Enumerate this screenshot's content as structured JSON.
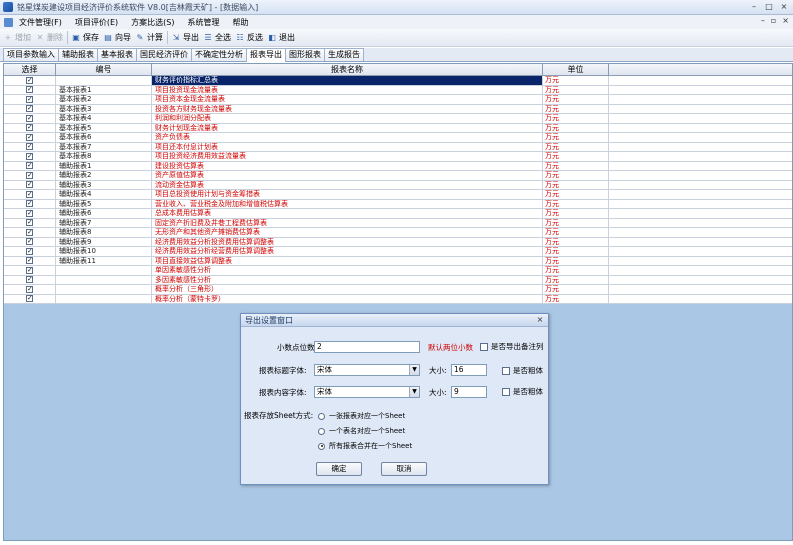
{
  "window": {
    "title": "铭星煤炭建设项目经济评价系统软件 V8.0[吉林霞天矿] - [数据输入]",
    "controls": {
      "minimize": "–",
      "maximize": "□",
      "close": "×"
    }
  },
  "menubar": {
    "items": [
      "文件管理(F)",
      "项目评价(E)",
      "方案比选(S)",
      "系统管理",
      "帮助"
    ],
    "sub_controls": {
      "minimize": "–",
      "restore": "▫",
      "close": "×"
    }
  },
  "toolbar": {
    "buttons": [
      {
        "label": "增加",
        "icon": "add-icon",
        "glyph": "+",
        "enabled": false
      },
      {
        "label": "删除",
        "icon": "delete-icon",
        "glyph": "✕",
        "enabled": false
      },
      {
        "label": "保存",
        "icon": "save-icon",
        "glyph": "▣",
        "enabled": true
      },
      {
        "label": "向导",
        "icon": "wizard-icon",
        "glyph": "▤",
        "enabled": true
      },
      {
        "label": "计算",
        "icon": "calculate-icon",
        "glyph": "✎",
        "enabled": true
      },
      {
        "label": "导出",
        "icon": "export-icon",
        "glyph": "⇲",
        "enabled": true
      },
      {
        "label": "全选",
        "icon": "select-all-icon",
        "glyph": "☰",
        "enabled": true
      },
      {
        "label": "反选",
        "icon": "invert-selection-icon",
        "glyph": "☷",
        "enabled": true
      },
      {
        "label": "退出",
        "icon": "exit-icon",
        "glyph": "◧",
        "enabled": true
      }
    ]
  },
  "tabs": {
    "items": [
      "项目参数输入",
      "辅助报表",
      "基本报表",
      "国民经济评价",
      "不确定性分析",
      "报表导出",
      "图形报表",
      "生成报告"
    ],
    "active_index": 5
  },
  "grid": {
    "headers": {
      "select": "选择",
      "code": "编号",
      "name": "报表名称",
      "unit": "单位"
    },
    "rows": [
      {
        "code": "",
        "name": "财务评价指标汇总表",
        "unit": "万元",
        "checked": true,
        "selected": true
      },
      {
        "code": "基本报表1",
        "name": "项目投资现金流量表",
        "unit": "万元",
        "checked": true
      },
      {
        "code": "基本报表2",
        "name": "项目资本金现金流量表",
        "unit": "万元",
        "checked": true
      },
      {
        "code": "基本报表3",
        "name": "投资各方财务现金流量表",
        "unit": "万元",
        "checked": true
      },
      {
        "code": "基本报表4",
        "name": "利润和利润分配表",
        "unit": "万元",
        "checked": true
      },
      {
        "code": "基本报表5",
        "name": "财务计划现金流量表",
        "unit": "万元",
        "checked": true
      },
      {
        "code": "基本报表6",
        "name": "资产负债表",
        "unit": "万元",
        "checked": true
      },
      {
        "code": "基本报表7",
        "name": "项目还本付息计划表",
        "unit": "万元",
        "checked": true
      },
      {
        "code": "基本报表8",
        "name": "项目投资经济费用效益流量表",
        "unit": "万元",
        "checked": true
      },
      {
        "code": "辅助报表1",
        "name": "建设投资估算表",
        "unit": "万元",
        "checked": true
      },
      {
        "code": "辅助报表2",
        "name": "资产原值估算表",
        "unit": "万元",
        "checked": true
      },
      {
        "code": "辅助报表3",
        "name": "流动资金估算表",
        "unit": "万元",
        "checked": true
      },
      {
        "code": "辅助报表4",
        "name": "项目总投资使用计划与资金筹措表",
        "unit": "万元",
        "checked": true
      },
      {
        "code": "辅助报表5",
        "name": "营业收入、营业税金及附加和增值税估算表",
        "unit": "万元",
        "checked": true
      },
      {
        "code": "辅助报表6",
        "name": "总成本费用估算表",
        "unit": "万元",
        "checked": true
      },
      {
        "code": "辅助报表7",
        "name": "固定资产折旧费及井巷工程费估算表",
        "unit": "万元",
        "checked": true
      },
      {
        "code": "辅助报表8",
        "name": "无形资产和其他资产摊销费估算表",
        "unit": "万元",
        "checked": true
      },
      {
        "code": "辅助报表9",
        "name": "经济费用效益分析投资费用估算调整表",
        "unit": "万元",
        "checked": true
      },
      {
        "code": "辅助报表10",
        "name": "经济费用效益分析经营费用估算调整表",
        "unit": "万元",
        "checked": true
      },
      {
        "code": "辅助报表11",
        "name": "项目直接效益估算调整表",
        "unit": "万元",
        "checked": true
      },
      {
        "code": "",
        "name": "单因素敏感性分析",
        "unit": "万元",
        "checked": true
      },
      {
        "code": "",
        "name": "多因素敏感性分析",
        "unit": "万元",
        "checked": true
      },
      {
        "code": "",
        "name": "概率分析（三角形）",
        "unit": "万元",
        "checked": true
      },
      {
        "code": "",
        "name": "概率分析（蒙特卡罗）",
        "unit": "万元",
        "checked": true
      }
    ]
  },
  "dialog": {
    "title": "导出设置窗口",
    "close": "×",
    "decimal_label": "小数点位数:",
    "decimal_value": "2",
    "decimal_hint": "默认两位小数",
    "export_remark_label": "是否导出备注列",
    "title_font_label": "报表标题字体:",
    "title_font_value": "宋体",
    "title_size_label": "大小:",
    "title_size_value": "16",
    "bold_label": "是否粗体",
    "content_font_label": "报表内容字体:",
    "content_font_value": "宋体",
    "content_size_label": "大小:",
    "content_size_value": "9",
    "border_label": "是否粗体",
    "sheet_mode_label": "报表存放Sheet方式:",
    "sheet_options": [
      "一张报表对应一个Sheet",
      "一个表名对应一个Sheet",
      "所有报表合并在一个Sheet"
    ],
    "sheet_selected": 2,
    "ok_label": "确定",
    "cancel_label": "取消"
  },
  "colors": {
    "accent": "#0a246a",
    "highlight_text": "#d00000",
    "grid_bg": "#abc7e6"
  }
}
